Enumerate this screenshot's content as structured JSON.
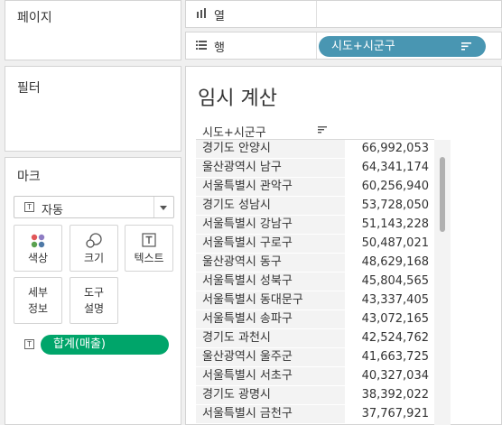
{
  "pages_card": {
    "title": "페이지"
  },
  "filters_card": {
    "title": "필터"
  },
  "marks_card": {
    "title": "마크",
    "mark_type": "자동",
    "buttons": {
      "color": "색상",
      "size": "크기",
      "text": "텍스트",
      "detail_line1": "세부",
      "detail_line2": "정보",
      "tooltip_line1": "도구",
      "tooltip_line2": "설명"
    },
    "text_pill": "합계(매출)"
  },
  "shelves": {
    "columns_label": "열",
    "rows_label": "행",
    "row_pill": "시도+시군구"
  },
  "view": {
    "title": "임시 계산",
    "header": "시도+시군구",
    "rows": [
      {
        "name": "경기도 안양시",
        "value": "66,992,053"
      },
      {
        "name": "울산광역시 남구",
        "value": "64,341,174"
      },
      {
        "name": "서울특별시 관악구",
        "value": "60,256,940"
      },
      {
        "name": "경기도 성남시",
        "value": "53,728,050"
      },
      {
        "name": "서울특별시 강남구",
        "value": "51,143,228"
      },
      {
        "name": "서울특별시 구로구",
        "value": "50,487,021"
      },
      {
        "name": "울산광역시 동구",
        "value": "48,629,168"
      },
      {
        "name": "서울특별시 성북구",
        "value": "45,804,565"
      },
      {
        "name": "서울특별시 동대문구",
        "value": "43,337,405"
      },
      {
        "name": "서울특별시 송파구",
        "value": "43,072,165"
      },
      {
        "name": "경기도 과천시",
        "value": "42,524,762"
      },
      {
        "name": "울산광역시 울주군",
        "value": "41,663,725"
      },
      {
        "name": "서울특별시 서초구",
        "value": "40,327,034"
      },
      {
        "name": "경기도 광명시",
        "value": "38,392,022"
      },
      {
        "name": "서울특별시 금천구",
        "value": "37,767,921"
      }
    ]
  },
  "colors": {
    "row_pill": "#4996b2",
    "text_pill": "#00a56a",
    "row_band": "#f3f3f3"
  }
}
